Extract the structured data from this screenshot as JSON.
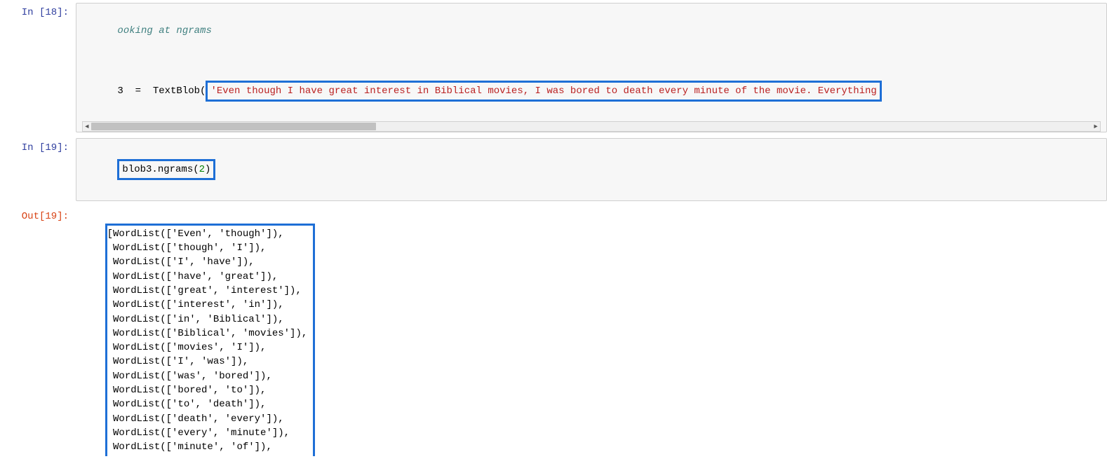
{
  "cell18": {
    "prompt": "In [18]:",
    "comment": "ooking at ngrams",
    "line2_prefix": "3  =  TextBlob(",
    "string": "'Even though I have great interest in Biblical movies, I was bored to death every minute of the movie. Everything"
  },
  "cell19_in": {
    "prompt": "In [19]:",
    "code_prefix": "blob3.ngrams(",
    "num": "2",
    "code_suffix": ")"
  },
  "cell19_out": {
    "prompt": "Out[19]:",
    "lines": [
      "[WordList(['Even', 'though']),",
      " WordList(['though', 'I']),",
      " WordList(['I', 'have']),",
      " WordList(['have', 'great']),",
      " WordList(['great', 'interest']),",
      " WordList(['interest', 'in']),",
      " WordList(['in', 'Biblical']),",
      " WordList(['Biblical', 'movies']),",
      " WordList(['movies', 'I']),",
      " WordList(['I', 'was']),",
      " WordList(['was', 'bored']),",
      " WordList(['bored', 'to']),",
      " WordList(['to', 'death']),",
      " WordList(['death', 'every']),",
      " WordList(['every', 'minute']),",
      " WordList(['minute', 'of']),"
    ]
  }
}
